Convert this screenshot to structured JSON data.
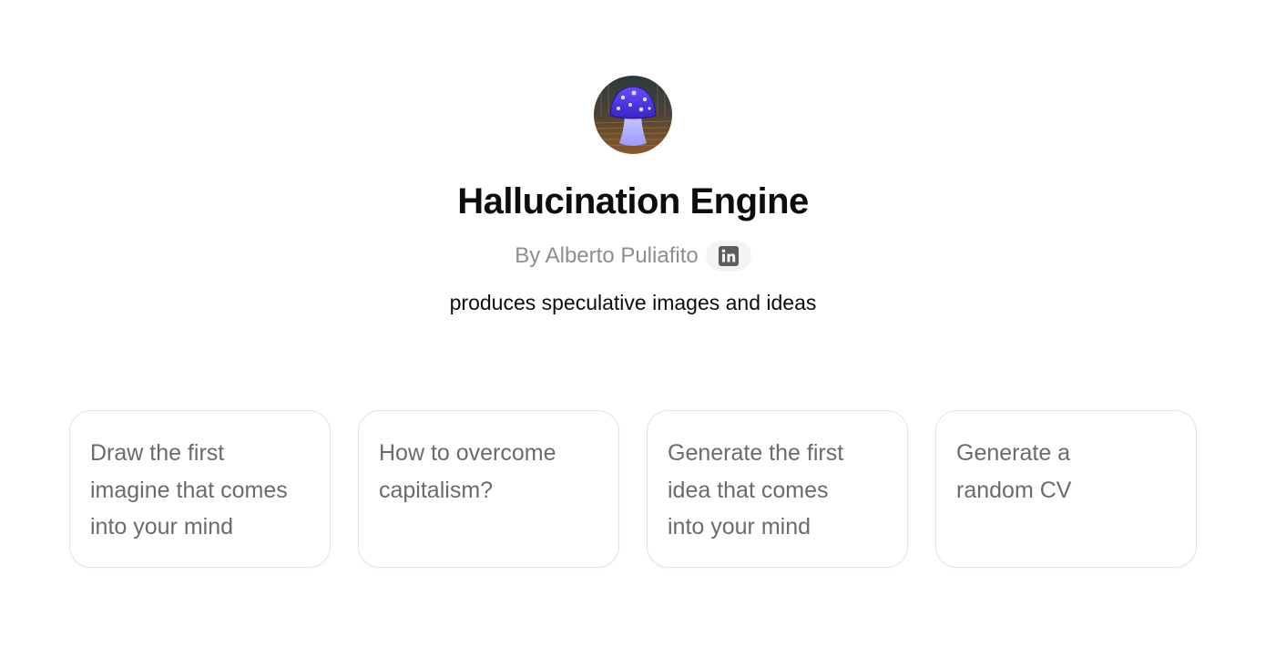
{
  "header": {
    "avatar_icon": "blue-mushroom-avatar",
    "title": "Hallucination Engine",
    "author": "By Alberto Puliafito",
    "author_link_icon": "linkedin-icon",
    "description": "produces speculative images and ideas"
  },
  "prompts": [
    {
      "label": "Draw the first\nimagine that comes\ninto your mind"
    },
    {
      "label": "How to overcome\ncapitalism?"
    },
    {
      "label": "Generate the first\nidea that comes\ninto your mind"
    },
    {
      "label": "Generate a\nrandom CV"
    }
  ],
  "colors": {
    "title": "#0d0d0d",
    "muted": "#8e8e8e",
    "card_text": "#6b6b6b",
    "card_border": "#e3e3e3",
    "mushroom_cap": "#5a3cf0"
  }
}
